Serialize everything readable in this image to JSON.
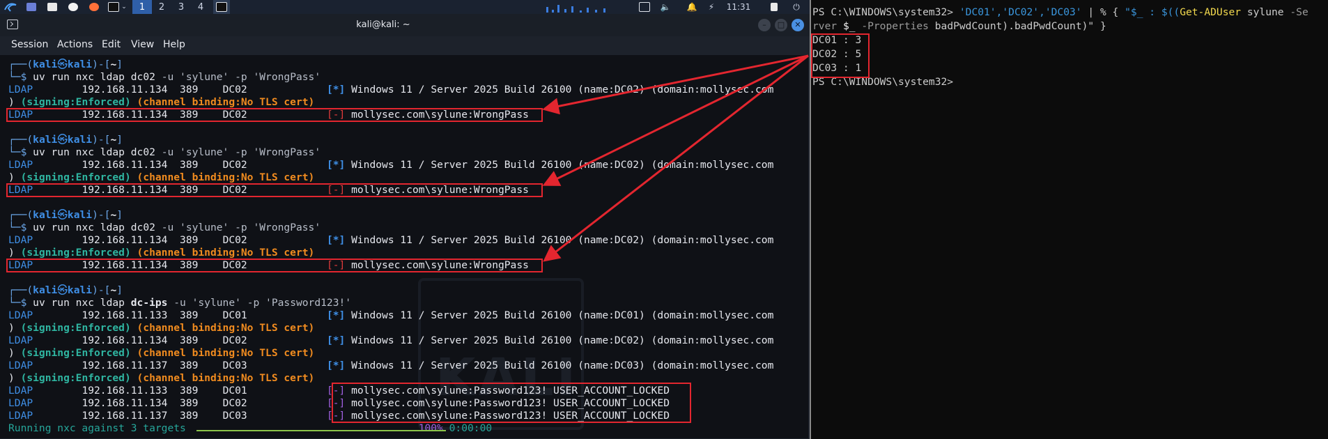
{
  "taskbar": {
    "workspaces": [
      "1",
      "2",
      "3",
      "4"
    ],
    "clock": "11:31"
  },
  "terminal": {
    "title": "kali@kali: ~",
    "menu": [
      "Session",
      "Actions",
      "Edit",
      "View",
      "Help"
    ],
    "prompt": {
      "user": "kali",
      "skull": "㉿",
      "host": "kali",
      "dir": "~",
      "top": "┌──(",
      "bottom": "└─$ "
    },
    "blocks": [
      {
        "cmd": "uv run nxc ldap ",
        "target": "dc02",
        "args": " -u 'sylune' -p 'WrongPass'"
      },
      {
        "cmd": "uv run nxc ldap ",
        "target": "dc02",
        "args": " -u 'sylune' -p 'WrongPass'"
      },
      {
        "cmd": "uv run nxc ldap ",
        "target": "dc02",
        "args": " -u 'sylune' -p 'WrongPass'"
      },
      {
        "cmd": "uv run nxc ldap ",
        "target": "dc-ips",
        "args": " -u 'sylune' -p 'Password123!'"
      }
    ],
    "ldap": "LDAP",
    "info_tag": "[*]",
    "fail_tag": "[-]",
    "rows": {
      "dc02_info": {
        "ip": "192.168.11.134",
        "port": "389",
        "host": "DC02",
        "msg": "Windows 11 / Server 2025 Build 26100 (name:DC02) (domain:mollysec.com"
      },
      "dc01_info": {
        "ip": "192.168.11.133",
        "port": "389",
        "host": "DC01",
        "msg": "Windows 11 / Server 2025 Build 26100 (name:DC01) (domain:mollysec.com"
      },
      "dc03_info": {
        "ip": "192.168.11.137",
        "port": "389",
        "host": "DC03",
        "msg": "Windows 11 / Server 2025 Build 26100 (name:DC03) (domain:mollysec.com"
      },
      "wrongpass": "mollysec.com\\sylune:WrongPass",
      "locked": "mollysec.com\\sylune:Password123! USER_ACCOUNT_LOCKED"
    },
    "signing_open": ") ",
    "signing": "(signing:Enforced)",
    "channel": "(channel binding:No TLS cert)",
    "progress_label": "Running nxc against 3 targets",
    "progress_pct": "100%",
    "progress_time": "0:00:00",
    "progress_value": 1.0,
    "watermark": "KALI"
  },
  "powershell": {
    "prompt": "PS C:\\WINDOWS\\system32> ",
    "line1_list": "'DC01','DC02','DC03'",
    "line1_pipe": " | % { ",
    "line1_str1": "\"$_ : $((",
    "line1_cmdlet": "Get-ADUser",
    "line1_arg": " sylune ",
    "line1_param": "-Se",
    "line2_param": "rver",
    "line2_var": " $_ ",
    "line2_param2": "-Properties",
    "line2_rest": " badPwdCount).badPwdCount)\" }",
    "results": [
      "DC01 : 3",
      "DC02 : 5",
      "DC03 : 1"
    ],
    "prompt2": "PS C:\\WINDOWS\\system32>"
  },
  "colors": {
    "annotation_red": "#e3262f",
    "kali_blue": "#3f8fe6",
    "fail_red": "#e23b3b",
    "locked_purple": "#a060e0"
  }
}
